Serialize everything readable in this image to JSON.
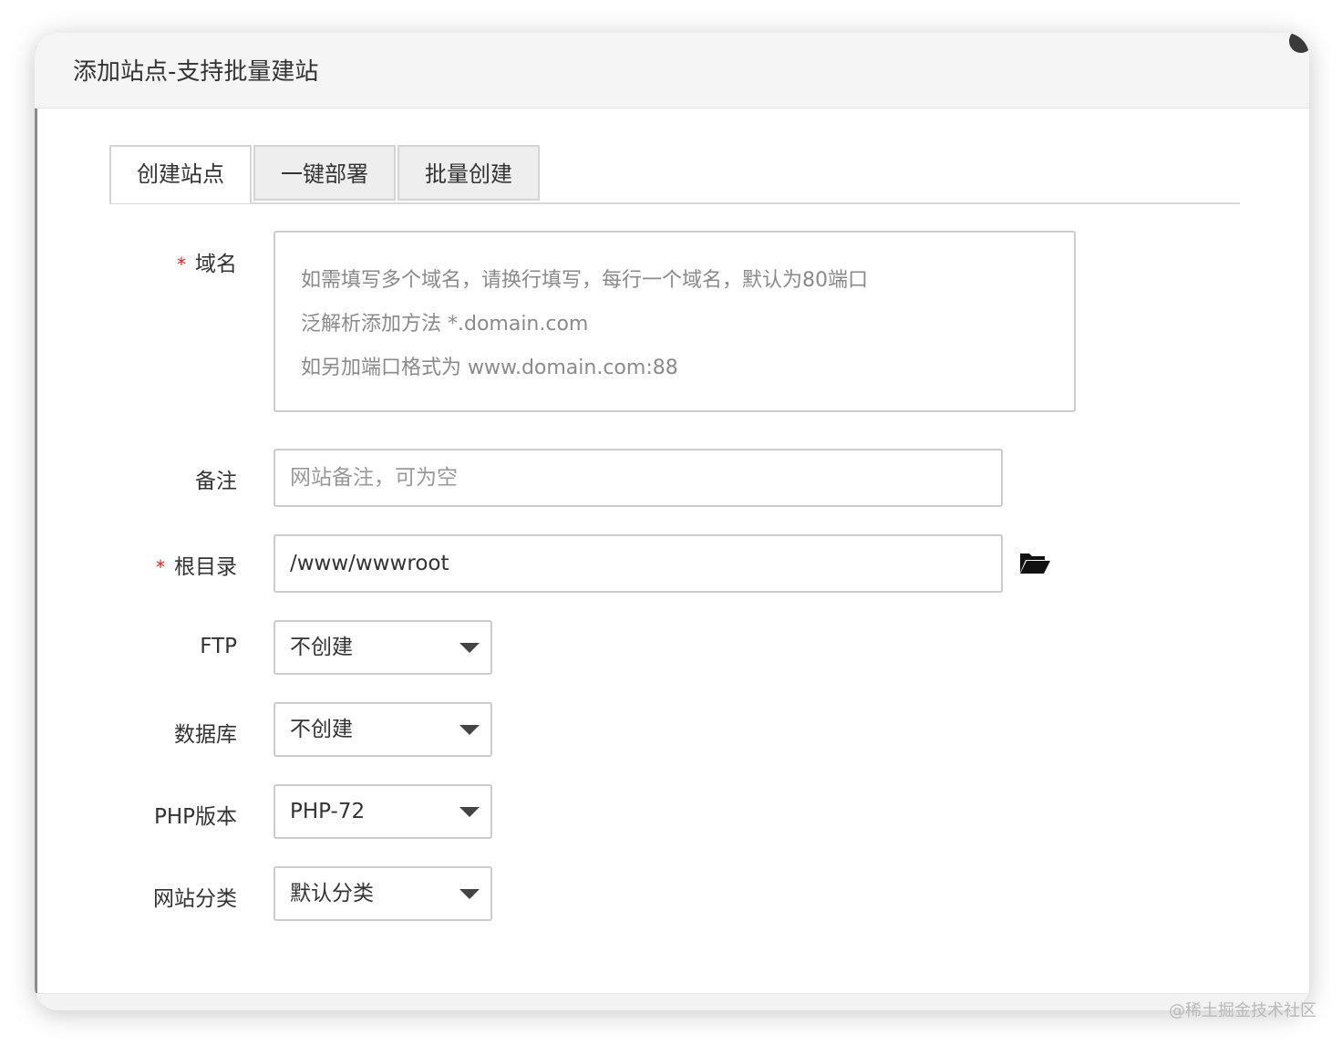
{
  "dialog": {
    "title": "添加站点-支持批量建站"
  },
  "tabs": [
    {
      "label": "创建站点",
      "active": true
    },
    {
      "label": "一键部署",
      "active": false
    },
    {
      "label": "批量创建",
      "active": false
    }
  ],
  "form": {
    "domain": {
      "required_mark": "*",
      "label": "域名",
      "placeholder_lines": [
        "如需填写多个域名，请换行填写，每行一个域名，默认为80端口",
        "泛解析添加方法 *.domain.com",
        "如另加端口格式为 www.domain.com:88"
      ]
    },
    "remark": {
      "label": "备注",
      "placeholder": "网站备注，可为空"
    },
    "root_dir": {
      "required_mark": "*",
      "label": "根目录",
      "value": "/www/wwwroot",
      "icon": "folder-open-icon"
    },
    "ftp": {
      "label": "FTP",
      "value": "不创建"
    },
    "database": {
      "label": "数据库",
      "value": "不创建"
    },
    "php_version": {
      "label": "PHP版本",
      "value": "PHP-72"
    },
    "site_category": {
      "label": "网站分类",
      "value": "默认分类"
    }
  },
  "watermark": "@稀土掘金技术社区",
  "colors": {
    "required": "#e02020",
    "border": "#cccccc",
    "header_bg": "#f5f5f5"
  }
}
